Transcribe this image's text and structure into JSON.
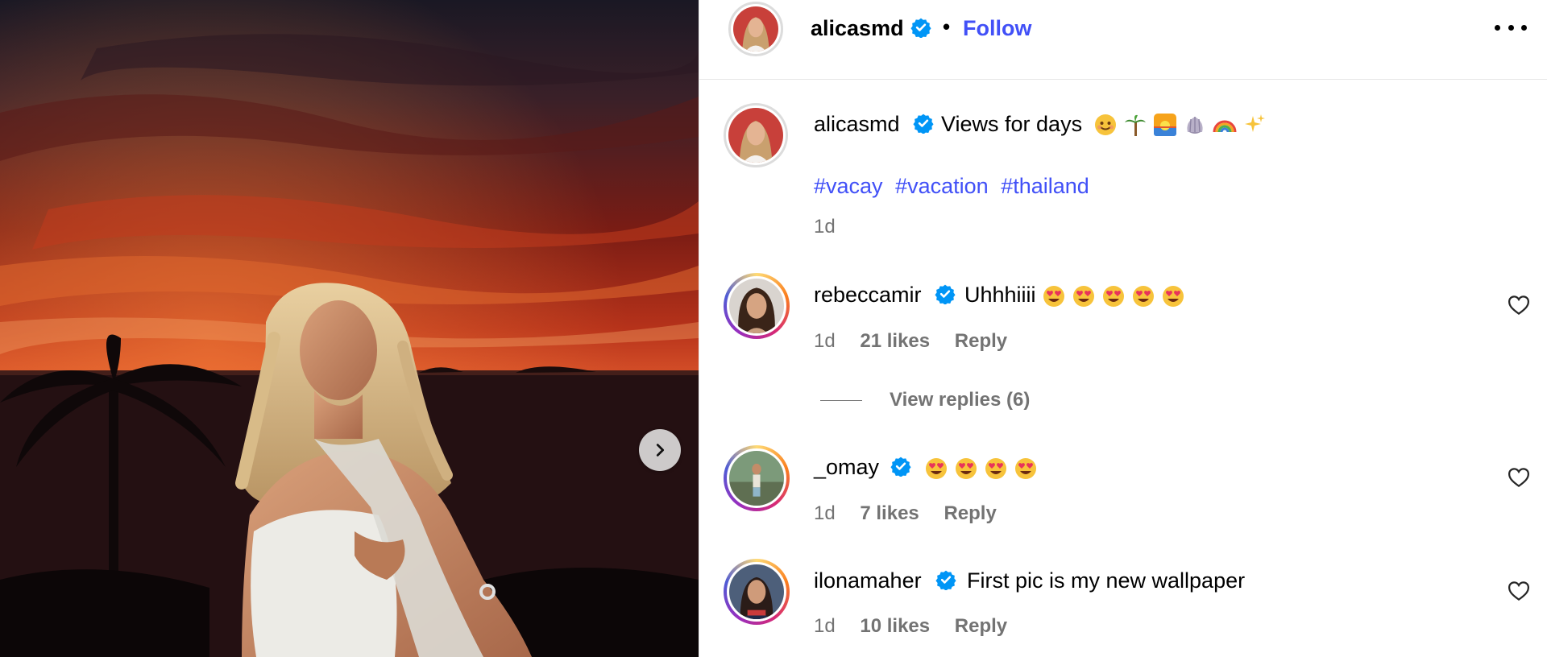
{
  "post": {
    "author": "alicasmd",
    "follow_label": "Follow",
    "separator": "•"
  },
  "caption": {
    "author": "alicasmd",
    "text": "Views for days",
    "emojis": [
      "smiling-face-icon",
      "palm-tree-icon",
      "sunrise-icon",
      "shell-icon",
      "rainbow-icon",
      "sparkles-icon"
    ],
    "hashtags": [
      "#vacay",
      "#vacation",
      "#thailand"
    ],
    "time": "1d"
  },
  "comments": [
    {
      "username": "rebeccamir",
      "text": "Uhhhiiii",
      "emoji_count": 5,
      "time": "1d",
      "likes": "21 likes",
      "reply": "Reply"
    },
    {
      "username": "_omay",
      "text": "",
      "emoji_count": 4,
      "time": "1d",
      "likes": "7 likes",
      "reply": "Reply"
    },
    {
      "username": "ilonamaher",
      "text": "First pic is my new wallpaper",
      "emoji_count": 0,
      "time": "1d",
      "likes": "10 likes",
      "reply": "Reply"
    }
  ],
  "view_replies": "View replies (6)",
  "colors": {
    "link": "#4150f7",
    "verified": "#0095f6",
    "muted": "#737373"
  }
}
